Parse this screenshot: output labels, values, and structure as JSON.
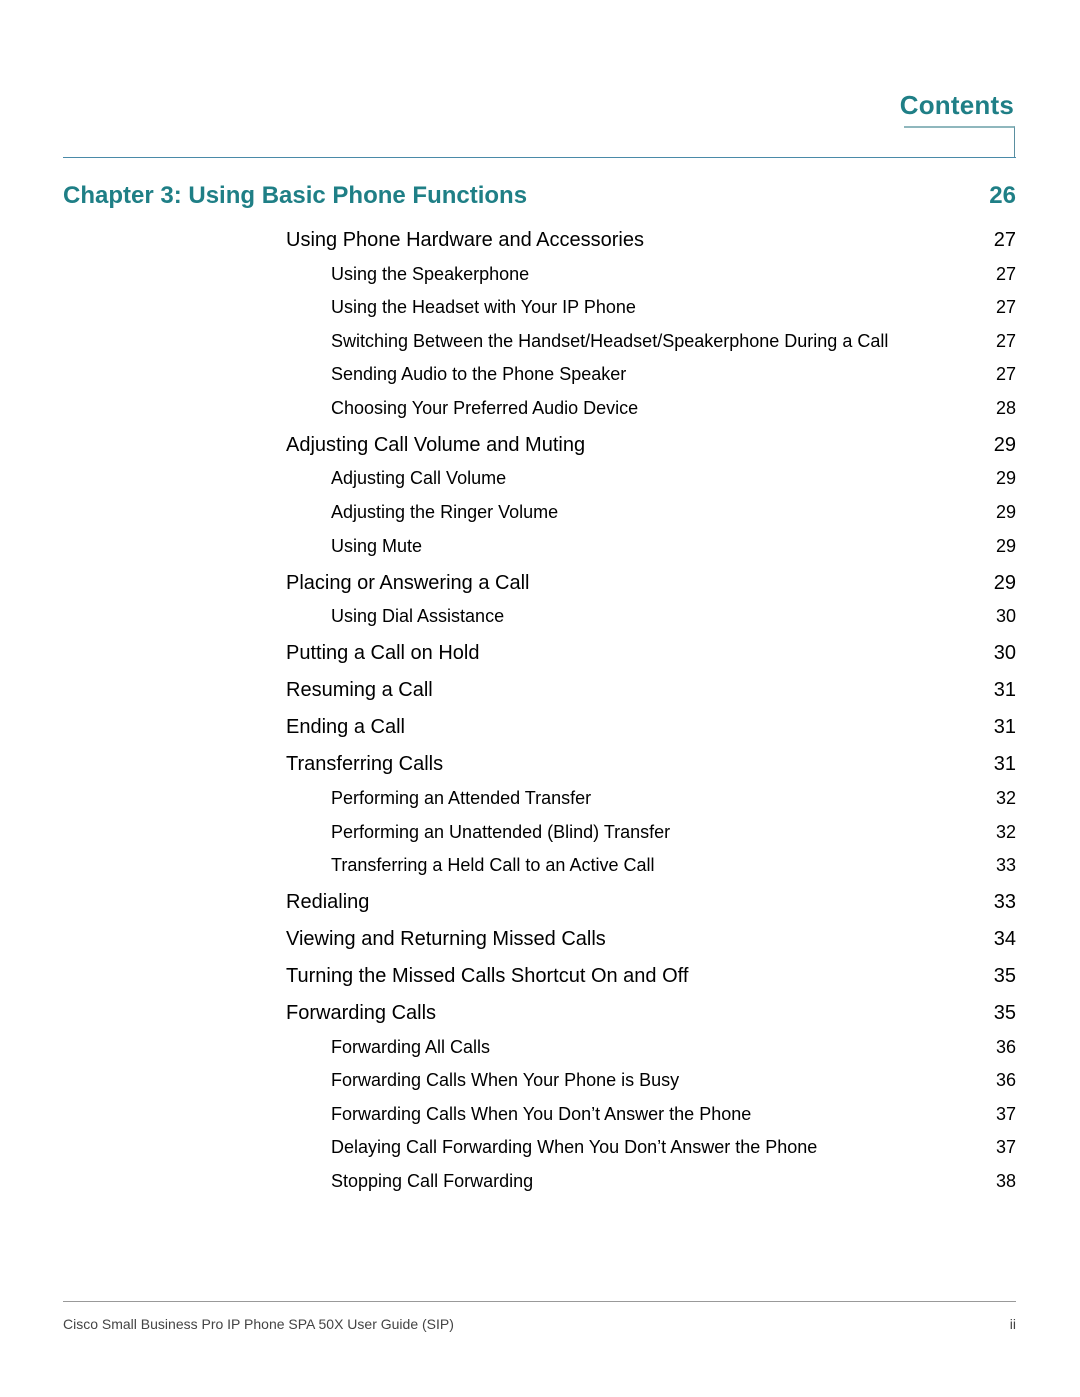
{
  "header": {
    "title": "Contents"
  },
  "chapter": {
    "label": "Chapter 3: Using Basic Phone Functions",
    "page": "26"
  },
  "entries": [
    {
      "level": 1,
      "title": "Using Phone Hardware and Accessories",
      "page": "27"
    },
    {
      "level": 2,
      "title": "Using the Speakerphone",
      "page": "27"
    },
    {
      "level": 2,
      "title": "Using the Headset with Your IP Phone",
      "page": "27"
    },
    {
      "level": 2,
      "title": "Switching Between the Handset/Headset/Speakerphone During a Call",
      "page": "27"
    },
    {
      "level": 2,
      "title": "Sending Audio to the Phone Speaker",
      "page": "27"
    },
    {
      "level": 2,
      "title": "Choosing Your Preferred Audio Device",
      "page": "28"
    },
    {
      "level": 1,
      "title": "Adjusting Call Volume and Muting",
      "page": "29"
    },
    {
      "level": 2,
      "title": "Adjusting Call Volume",
      "page": "29"
    },
    {
      "level": 2,
      "title": "Adjusting the Ringer Volume",
      "page": "29"
    },
    {
      "level": 2,
      "title": "Using Mute",
      "page": "29"
    },
    {
      "level": 1,
      "title": "Placing or Answering a Call",
      "page": "29"
    },
    {
      "level": 2,
      "title": "Using Dial Assistance",
      "page": "30"
    },
    {
      "level": 1,
      "title": "Putting a Call on Hold",
      "page": "30"
    },
    {
      "level": 1,
      "title": "Resuming a Call",
      "page": "31"
    },
    {
      "level": 1,
      "title": "Ending a Call",
      "page": "31"
    },
    {
      "level": 1,
      "title": "Transferring Calls",
      "page": "31"
    },
    {
      "level": 2,
      "title": "Performing an Attended Transfer",
      "page": "32"
    },
    {
      "level": 2,
      "title": "Performing an Unattended (Blind) Transfer",
      "page": "32"
    },
    {
      "level": 2,
      "title": "Transferring a Held Call to an Active Call",
      "page": "33"
    },
    {
      "level": 1,
      "title": "Redialing",
      "page": "33"
    },
    {
      "level": 1,
      "title": "Viewing and Returning Missed Calls",
      "page": "34"
    },
    {
      "level": 1,
      "title": "Turning the Missed Calls Shortcut On and Off",
      "page": "35"
    },
    {
      "level": 1,
      "title": "Forwarding Calls",
      "page": "35"
    },
    {
      "level": 2,
      "title": "Forwarding All Calls",
      "page": "36"
    },
    {
      "level": 2,
      "title": "Forwarding Calls When Your Phone is Busy",
      "page": "36"
    },
    {
      "level": 2,
      "title": "Forwarding Calls When You Don’t Answer the Phone",
      "page": "37"
    },
    {
      "level": 2,
      "title": "Delaying Call Forwarding When You Don’t Answer the Phone",
      "page": "37"
    },
    {
      "level": 2,
      "title": "Stopping Call Forwarding",
      "page": "38"
    }
  ],
  "footer": {
    "text": "Cisco Small Business Pro IP Phone SPA 50X User Guide (SIP)",
    "page": "ii"
  }
}
